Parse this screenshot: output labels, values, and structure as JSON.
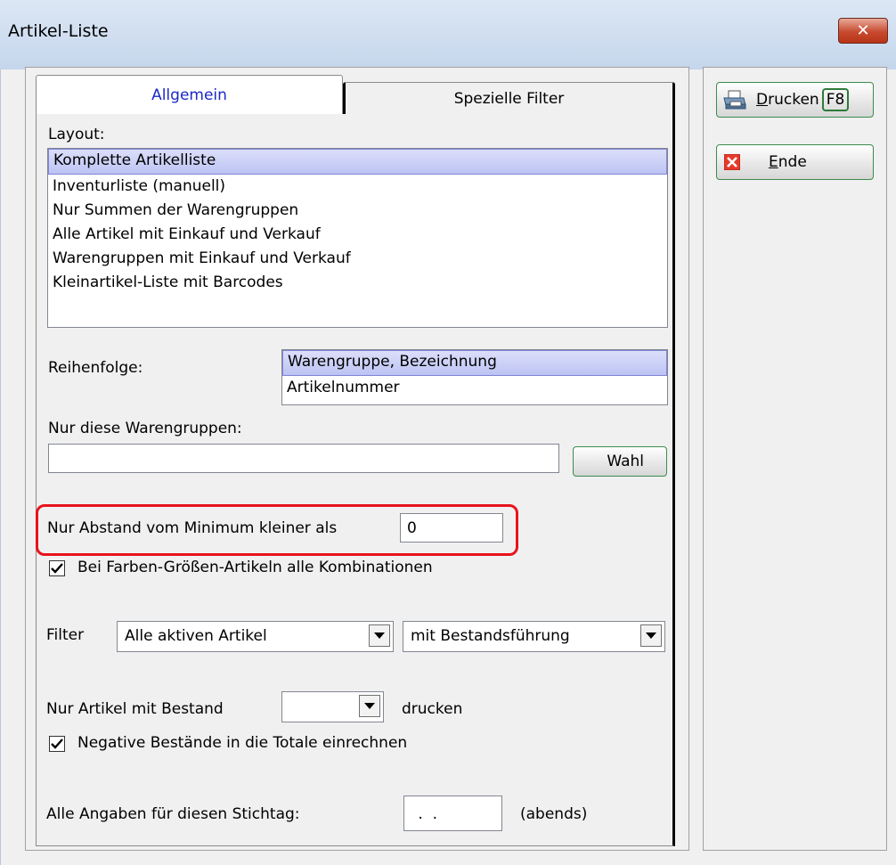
{
  "window": {
    "title": "Artikel-Liste",
    "close_glyph": "✕"
  },
  "tabs": [
    {
      "label": "Allgemein"
    },
    {
      "label": "Spezielle Filter"
    }
  ],
  "layout": {
    "label": "Layout:",
    "items": [
      "Komplette Artikelliste",
      "Inventurliste (manuell)",
      "Nur Summen der Warengruppen",
      "Alle Artikel mit Einkauf und Verkauf",
      "Warengruppen mit Einkauf und Verkauf",
      "Kleinartikel-Liste mit Barcodes"
    ],
    "selected": "Komplette Artikelliste"
  },
  "reihenfolge": {
    "label": "Reihenfolge:",
    "items": [
      "Warengruppe, Bezeichnung",
      "Artikelnummer"
    ],
    "selected": "Warengruppe, Bezeichnung"
  },
  "warengruppen": {
    "label": "Nur diese Warengruppen:",
    "value": "",
    "button": "Wahl"
  },
  "abstand": {
    "label": "Nur Abstand vom Minimum kleiner als",
    "value": "0"
  },
  "farben": {
    "checked": true,
    "label": "Bei Farben-Größen-Artikeln alle Kombinationen"
  },
  "filter": {
    "label": "Filter",
    "option1": "Alle aktiven Artikel",
    "option2": "mit Bestandsführung"
  },
  "bestand": {
    "label": "Nur Artikel mit Bestand",
    "value": "",
    "suffix": "drucken"
  },
  "negative": {
    "checked": true,
    "label": "Negative Bestände in die Totale einrechnen"
  },
  "stichtag": {
    "label": "Alle Angaben für diesen Stichtag:",
    "value": " .  .",
    "suffix": "(abends)"
  },
  "side_buttons": {
    "print": {
      "label_mnemonic": "D",
      "label_rest": "rucken",
      "shortcut": "F8"
    },
    "end": {
      "label_mnemonic": "E",
      "label_rest": "nde"
    }
  },
  "colors": {
    "selection": "#bcc3f3",
    "highlight_border": "#e8131c",
    "button_border": "#3c8c4c",
    "tab_active_text": "#1b28c8"
  }
}
